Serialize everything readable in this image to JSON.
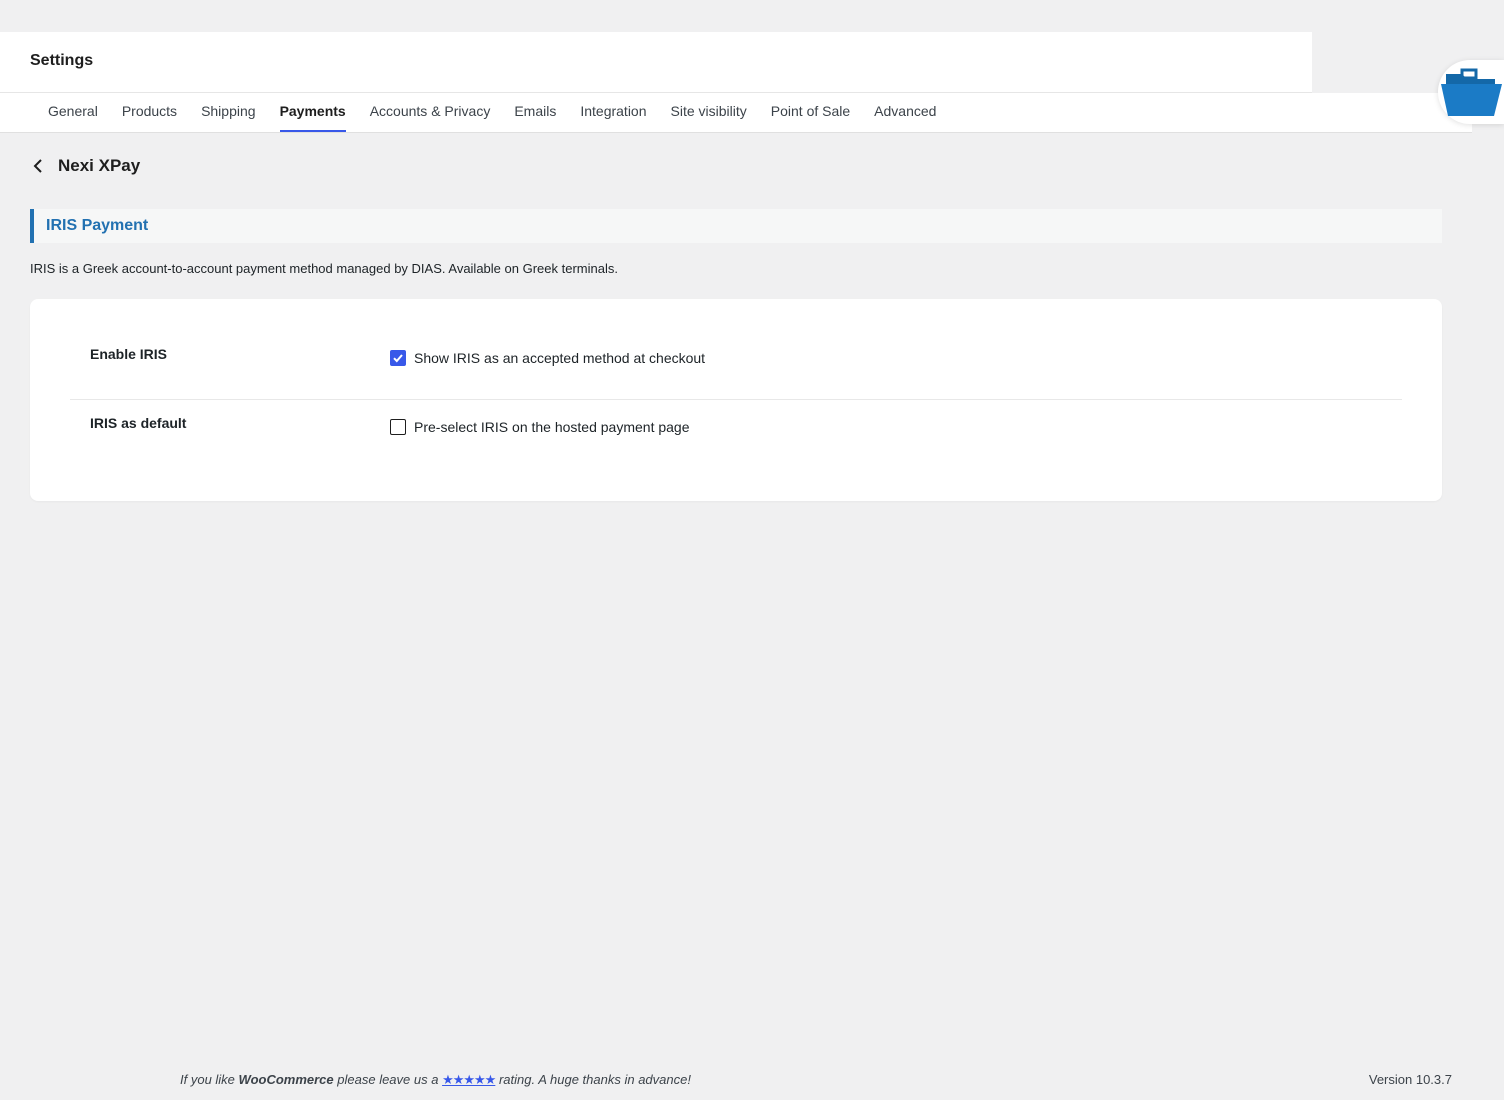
{
  "header": {
    "title": "Settings"
  },
  "tabs": [
    {
      "label": "General",
      "active": false
    },
    {
      "label": "Products",
      "active": false
    },
    {
      "label": "Shipping",
      "active": false
    },
    {
      "label": "Payments",
      "active": true
    },
    {
      "label": "Accounts & Privacy",
      "active": false
    },
    {
      "label": "Emails",
      "active": false
    },
    {
      "label": "Integration",
      "active": false
    },
    {
      "label": "Site visibility",
      "active": false
    },
    {
      "label": "Point of Sale",
      "active": false
    },
    {
      "label": "Advanced",
      "active": false
    }
  ],
  "page": {
    "back_title": "Nexi XPay"
  },
  "section": {
    "title": "IRIS Payment",
    "description": "IRIS is a Greek account-to-account payment method managed by DIAS. Available on Greek terminals."
  },
  "settings": [
    {
      "label": "Enable IRIS",
      "control_label": "Show IRIS as an accepted method at checkout",
      "checked": true
    },
    {
      "label": "IRIS as default",
      "control_label": "Pre-select IRIS on the hosted payment page",
      "checked": false
    }
  ],
  "footer": {
    "prefix": "If you like ",
    "brand": "WooCommerce",
    "middle": " please leave us a ",
    "stars": "★★★★★",
    "suffix": " rating. A huge thanks in advance!",
    "version": "Version 10.3.7"
  },
  "icons": {
    "back": "chevron-left-icon",
    "floating": "folder-open-icon",
    "check": "checkmark-icon"
  },
  "colors": {
    "accent": "#3858e9",
    "section_title": "#2271b1",
    "folder": "#1b7bc6"
  }
}
